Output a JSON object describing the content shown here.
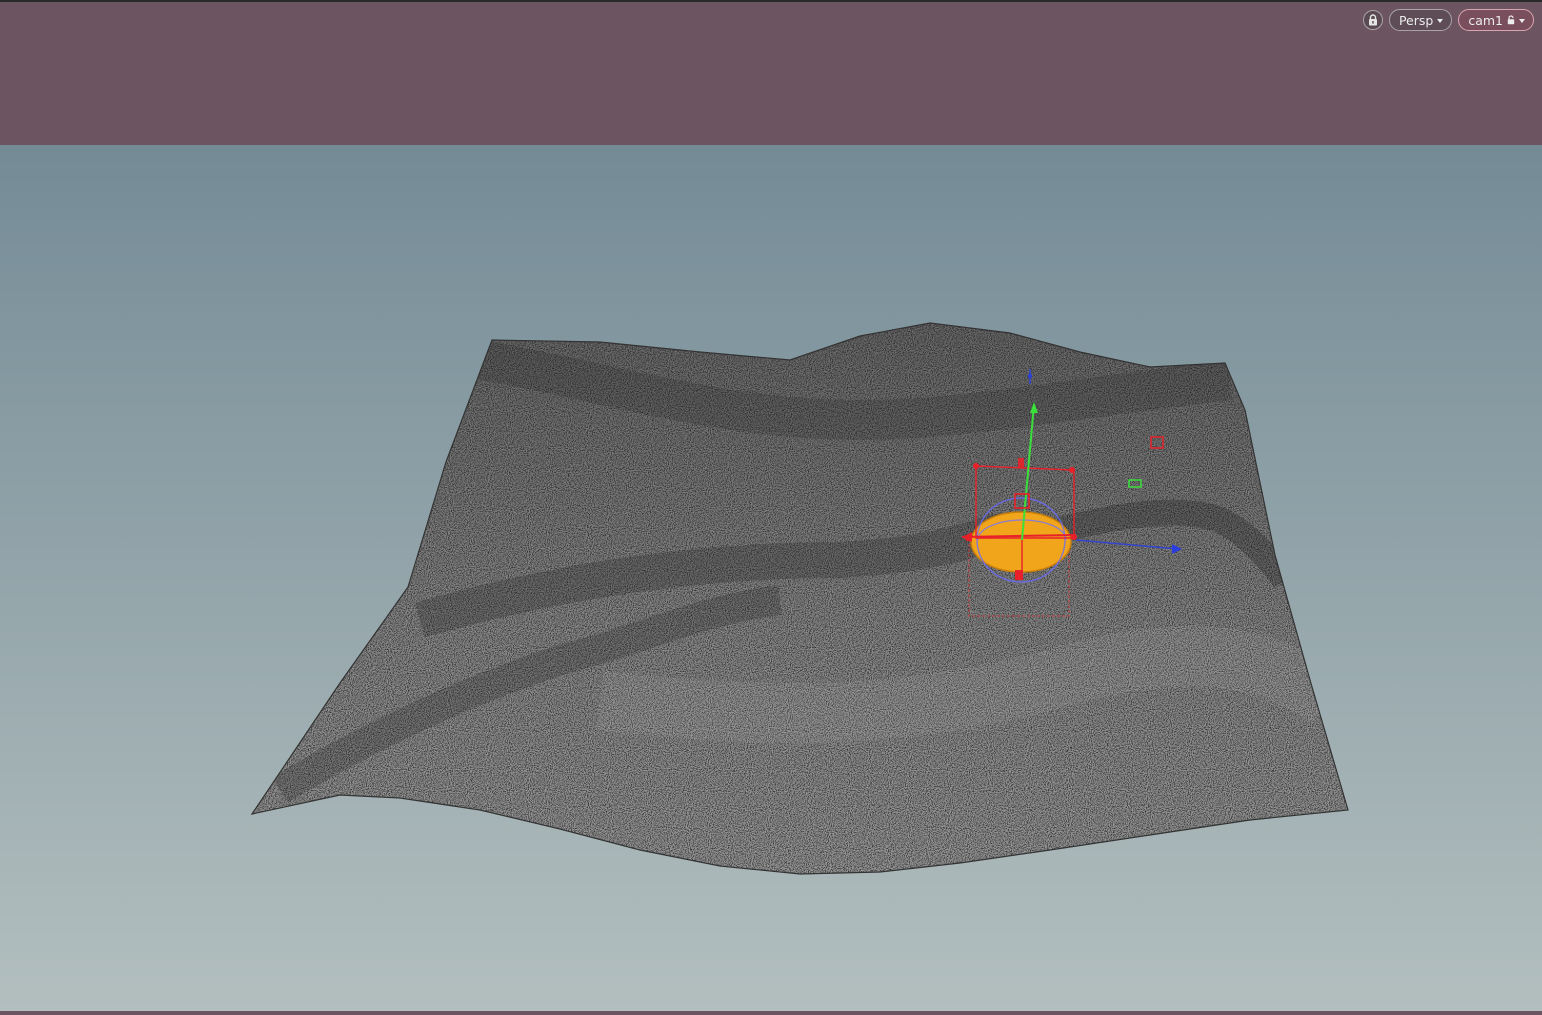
{
  "viewport": {
    "view_mode_label": "Persp",
    "camera_label": "cam1",
    "colors": {
      "camera_band": "#6c5560",
      "sky_top": "#748b96",
      "sky_bottom": "#b3bfbf",
      "terrain_light": "#b0b0b0",
      "terrain_dark": "#2e2e2e",
      "selection_orange": "#f0a51a",
      "handle_red": "#e8202a",
      "axis_green": "#3adf3a",
      "axis_blue": "#2b3fe0"
    },
    "icons": {
      "lock": "lock-icon",
      "dropdown": "chevron-down-icon",
      "camera_lock": "lock-icon"
    }
  }
}
